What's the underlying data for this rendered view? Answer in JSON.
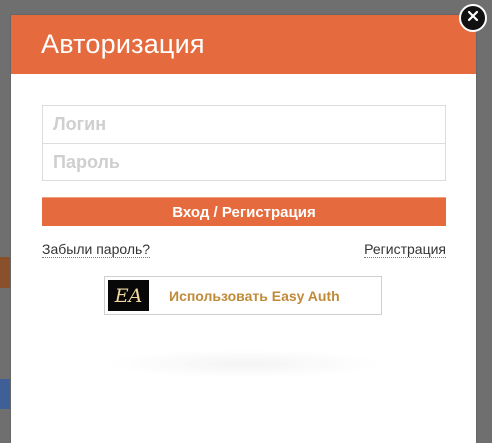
{
  "dialog": {
    "title": "Авторизация",
    "close_icon": "close-icon"
  },
  "form": {
    "login": {
      "placeholder": "Логин",
      "value": ""
    },
    "password": {
      "placeholder": "Пароль",
      "value": ""
    },
    "submit_label": "Вход / Регистрация",
    "forgot_password_label": "Забыли пароль?",
    "register_label": "Регистрация"
  },
  "easy_auth": {
    "logo_text": "EA",
    "label": "Использовать Easy Auth"
  },
  "colors": {
    "accent": "#e56b3f",
    "overlay": "#6f6f6f",
    "easy_auth_text": "#c08b39",
    "logo_bg": "#080808"
  }
}
